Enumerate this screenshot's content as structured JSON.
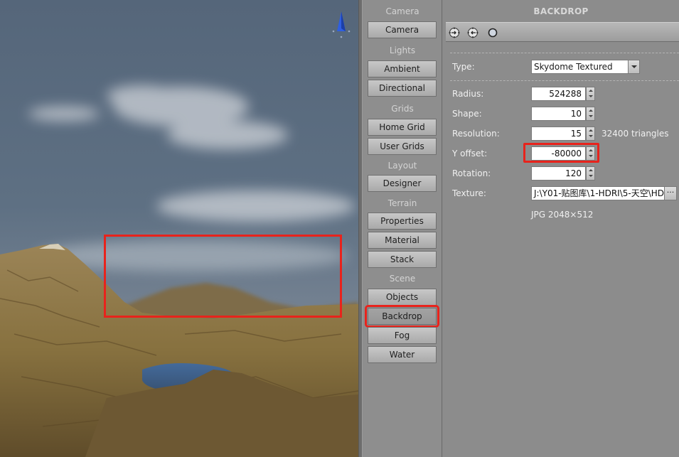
{
  "nav": {
    "sections": [
      {
        "title": "Camera",
        "buttons": [
          "Camera"
        ]
      },
      {
        "title": "Lights",
        "buttons": [
          "Ambient",
          "Directional"
        ]
      },
      {
        "title": "Grids",
        "buttons": [
          "Home Grid",
          "User Grids"
        ]
      },
      {
        "title": "Layout",
        "buttons": [
          "Designer"
        ]
      },
      {
        "title": "Terrain",
        "buttons": [
          "Properties",
          "Material",
          "Stack"
        ]
      },
      {
        "title": "Scene",
        "buttons": [
          "Objects",
          "Backdrop",
          "Fog",
          "Water"
        ]
      }
    ],
    "active": "Backdrop"
  },
  "panel": {
    "title": "BACKDROP",
    "type": {
      "label": "Type:",
      "value": "Skydome Textured"
    },
    "radius": {
      "label": "Radius:",
      "value": "524288"
    },
    "shape": {
      "label": "Shape:",
      "value": "10"
    },
    "resolution": {
      "label": "Resolution:",
      "value": "15",
      "info": "32400 triangles"
    },
    "y_offset": {
      "label": "Y offset:",
      "value": "-80000"
    },
    "rotation": {
      "label": "Rotation:",
      "value": "120"
    },
    "texture": {
      "label": "Texture:",
      "value": "J:\\Y01-贴图库\\1-HDRI\\5-天空\\HD",
      "browse": "···",
      "info": "JPG 2048×512"
    }
  },
  "toolbar_icons": [
    "gear-in-icon",
    "gear-out-icon",
    "circle-icon"
  ],
  "colors": {
    "highlight": "#e8231c",
    "panel_bg": "#8c8c8c",
    "gizmo_blue": "#2f5fe0"
  }
}
